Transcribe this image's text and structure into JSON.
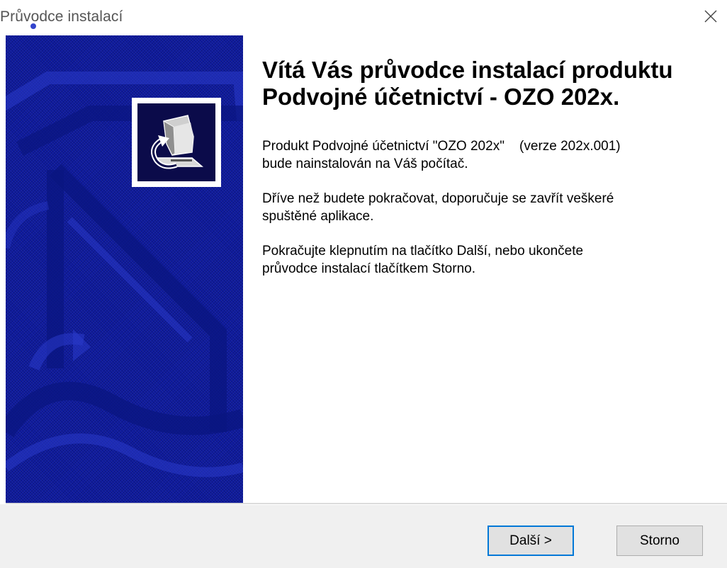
{
  "window": {
    "title": "Průvodce instalací"
  },
  "content": {
    "heading": "Vítá Vás průvodce instalací produktu Podvojné účetnictví - OZO 202x.",
    "paragraphs": [
      {
        "line1": "Produkt Podvojné účetnictví \"OZO 202x\"    (verze 202x.001)",
        "line2": "bude nainstalován na Váš počítač."
      },
      {
        "line1": "Dříve než budete pokračovat, doporučuje se zavřít veškeré",
        "line2": "spuštěné aplikace."
      },
      {
        "line1": "Pokračujte klepnutím na tlačítko Další, nebo ukončete",
        "line2": "průvodce instalací tlačítkem Storno."
      }
    ]
  },
  "buttons": {
    "next_label": "Další >",
    "cancel_label": "Storno"
  },
  "icons": {
    "close": "close-icon",
    "setup_logo": "computer-install-icon"
  },
  "colors": {
    "banner": "#0e1a9e",
    "primary_button_border": "#0078d7",
    "footer_background": "#f0f0f0"
  }
}
